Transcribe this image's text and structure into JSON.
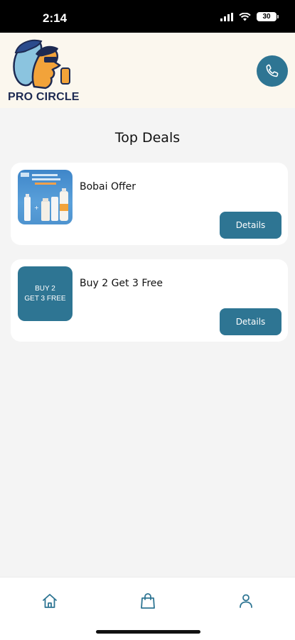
{
  "status_bar": {
    "time": "2:14",
    "battery": "30"
  },
  "header": {
    "logo_text": "PRO CIRCLE"
  },
  "page": {
    "title": "Top Deals"
  },
  "deals": [
    {
      "title": "Bobai Offer",
      "button": "Details",
      "thumb_line1": "",
      "thumb_line2": ""
    },
    {
      "title": "Buy 2 Get 3 Free",
      "button": "Details",
      "thumb_line1": "BUY 2",
      "thumb_line2": "GET 3 FREE"
    }
  ],
  "bottom_nav": {
    "items": [
      {
        "icon": "home-icon"
      },
      {
        "icon": "shopping-bag-icon"
      },
      {
        "icon": "user-icon"
      }
    ]
  },
  "colors": {
    "accent": "#2e7593",
    "header_bg": "#fbf7ee",
    "page_bg": "#f4f4f4",
    "logo_text": "#1d2a52"
  }
}
